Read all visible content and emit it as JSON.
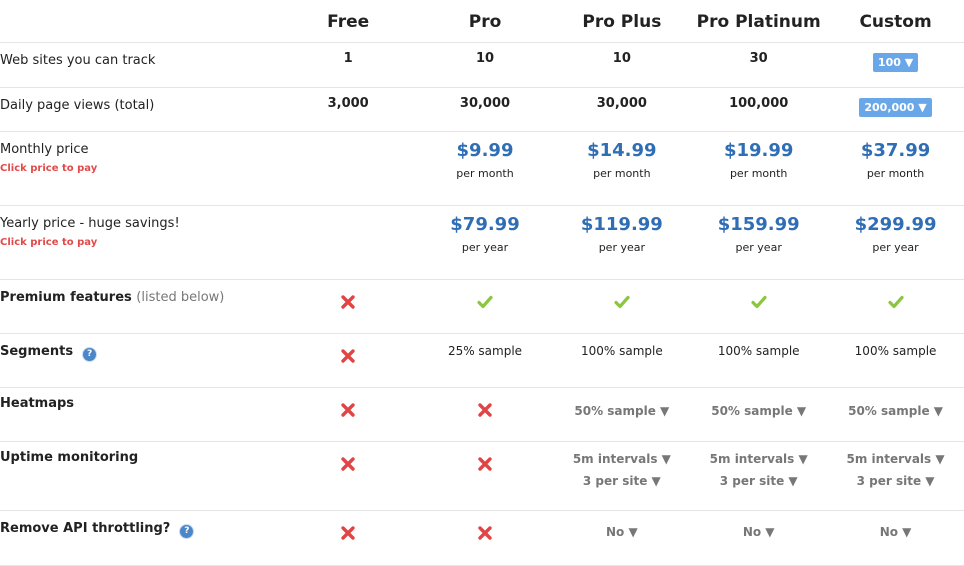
{
  "plans": [
    {
      "name": "Free"
    },
    {
      "name": "Pro"
    },
    {
      "name": "Pro Plus"
    },
    {
      "name": "Pro Platinum"
    },
    {
      "name": "Custom"
    }
  ],
  "rows": {
    "websites": {
      "label": "Web sites you can track",
      "values": [
        "1",
        "10",
        "10",
        "30",
        "100 ▼"
      ]
    },
    "pageviews": {
      "label": "Daily page views (total)",
      "values": [
        "3,000",
        "30,000",
        "30,000",
        "100,000",
        "200,000 ▼"
      ]
    },
    "monthly": {
      "label": "Monthly price",
      "hint": "Click price to pay",
      "prices": [
        "",
        "$9.99",
        "$14.99",
        "$19.99",
        "$37.99"
      ],
      "period": "per month"
    },
    "yearly": {
      "label": "Yearly price - huge savings!",
      "hint": "Click price to pay",
      "prices": [
        "",
        "$79.99",
        "$119.99",
        "$159.99",
        "$299.99"
      ],
      "period": "per year"
    },
    "premium": {
      "label": "Premium features",
      "note": "(listed below)",
      "values": [
        "no",
        "yes",
        "yes",
        "yes",
        "yes"
      ]
    },
    "segments": {
      "label": "Segments",
      "help": "?",
      "values": [
        "no",
        "25% sample",
        "100% sample",
        "100% sample",
        "100% sample"
      ]
    },
    "heatmaps": {
      "label": "Heatmaps",
      "values": [
        "no",
        "no",
        "50% sample ▼",
        "50% sample ▼",
        "50% sample ▼"
      ]
    },
    "uptime": {
      "label": "Uptime monitoring",
      "values": [
        "no",
        "no",
        "5m intervals ▼",
        "5m intervals ▼",
        "5m intervals ▼"
      ],
      "values2": [
        "",
        "",
        "3 per site ▼",
        "3 per site ▼",
        "3 per site ▼"
      ]
    },
    "api": {
      "label": "Remove API throttling?",
      "help": "?",
      "values": [
        "no",
        "no",
        "No ▼",
        "No ▼",
        "No ▼"
      ]
    }
  },
  "colors": {
    "price": "#2f6db5",
    "hint": "#e24a4a",
    "badge": "#6aa7e9",
    "check": "#8cc63e",
    "cross": "#e04444"
  }
}
